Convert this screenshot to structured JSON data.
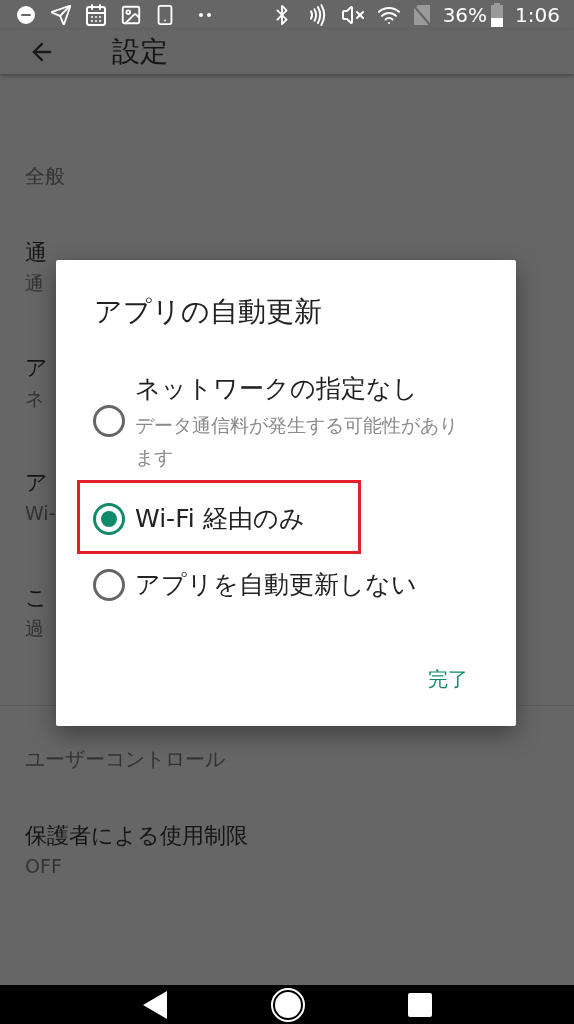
{
  "status_bar": {
    "battery": "36%",
    "time": "1:06"
  },
  "app_bar": {
    "title": "設定"
  },
  "sections": [
    {
      "header": "全般",
      "items": [
        {
          "title": "通",
          "subtitle": "通"
        },
        {
          "title": "ア",
          "subtitle": "ネ"
        },
        {
          "title": "ア",
          "subtitle": "Wi-"
        },
        {
          "title": "こ",
          "subtitle": "過"
        }
      ]
    },
    {
      "header": "ユーザーコントロール",
      "items": [
        {
          "title": "保護者による使用制限",
          "subtitle": "OFF"
        }
      ]
    }
  ],
  "dialog": {
    "title": "アプリの自動更新",
    "options": [
      {
        "label": "ネットワークの指定なし",
        "description": "データ通信料が発生する可能性があります",
        "selected": false,
        "highlighted": false
      },
      {
        "label": "Wi-Fi 経由のみ",
        "selected": true,
        "highlighted": true
      },
      {
        "label": "アプリを自動更新しない",
        "selected": false,
        "highlighted": false
      }
    ],
    "button": "完了"
  }
}
